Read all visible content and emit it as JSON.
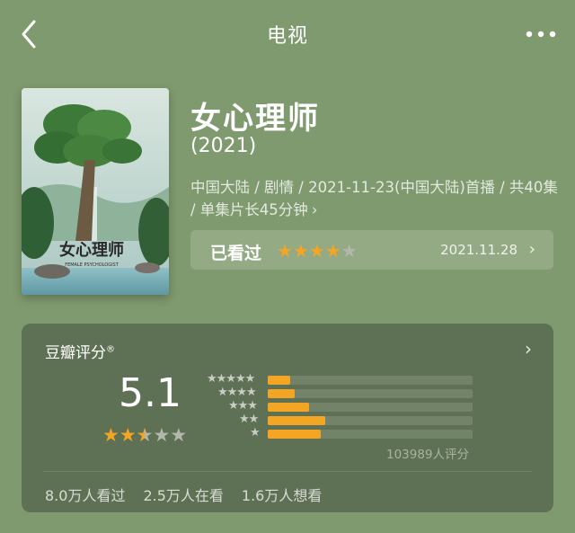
{
  "header": {
    "title": "电视",
    "back_icon": "chevron-left-icon",
    "more_icon": "more-dots-icon"
  },
  "poster": {
    "title_text": "女心理师",
    "tagline": "FEMALE PSYCHOLOGIST"
  },
  "show": {
    "title": "女心理师",
    "year": "(2021)",
    "meta": "中国大陆 / 剧情 / 2021-11-23(中国大陆)首播 / 共40集 / 单集片长45分钟",
    "meta_chevron": "›"
  },
  "watched": {
    "label": "已看过",
    "stars_filled": 4,
    "stars_total": 5,
    "date": "2021.11.28",
    "chevron": "›"
  },
  "rating": {
    "title": "豆瓣评分",
    "registered_mark": "®",
    "chevron": "›",
    "score": "5.1",
    "stars_value": 2.5,
    "distribution": [
      {
        "stars": 5,
        "percent": 11
      },
      {
        "stars": 4,
        "percent": 13
      },
      {
        "stars": 3,
        "percent": 20
      },
      {
        "stars": 2,
        "percent": 28
      },
      {
        "stars": 1,
        "percent": 26
      }
    ],
    "count_text": "103989人评分",
    "stats": [
      "8.0万人看过",
      "2.5万人在看",
      "1.6万人想看"
    ]
  },
  "colors": {
    "background": "#7f9a6e",
    "card": "#5f7154",
    "star_active": "#f5a524"
  }
}
